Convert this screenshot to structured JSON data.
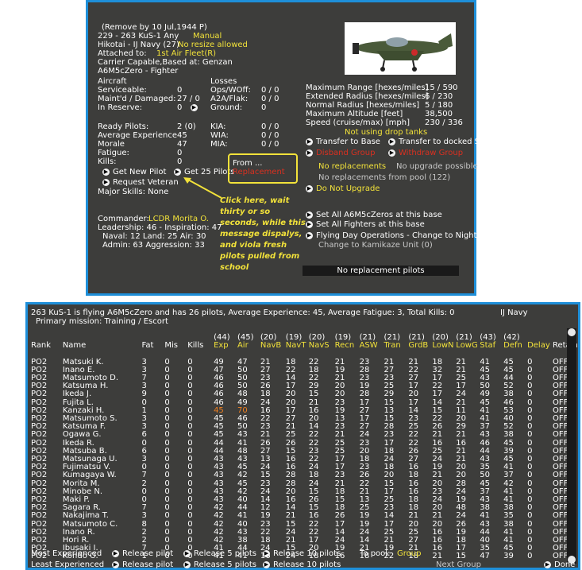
{
  "top": {
    "remove_note": "(Remove by 10 Jul,1944  P)",
    "unit_line": "229 - 263 KuS-1  Any",
    "manual": "Manual",
    "hikotai": "Hikotai - IJ Navy (27)",
    "no_resize": "No resize allowed",
    "attached_label": "Attached to:",
    "attached_value": "1st Air Fleet(R)",
    "carrier": "Carrier Capable,Based at:  Genzan",
    "aircraft_type": "A6M5cZero - Fighter",
    "aircraft_hdr": "Aircraft",
    "losses_hdr": "Losses",
    "left_stats": [
      {
        "label": "Serviceable:",
        "value": "0"
      },
      {
        "label": "Maint'd / Damaged:",
        "value": "27 / 0"
      },
      {
        "label": "In Reserve:",
        "value": "0"
      }
    ],
    "loss_stats": [
      {
        "label": "Ops/WOff:",
        "value": "0 / 0"
      },
      {
        "label": "A2A/Flak:",
        "value": "0 / 0"
      },
      {
        "label": "Ground:",
        "value": "0"
      }
    ],
    "range_stats": [
      {
        "label": "Maximum Range [hexes/miles]",
        "value": "15 / 590"
      },
      {
        "label": "Extended Radius [hexes/miles]",
        "value": "6 / 230"
      },
      {
        "label": "Normal Radius [hexes/miles]",
        "value": "5 / 180"
      },
      {
        "label": "Maximum Altitude [feet]",
        "value": "38,500"
      },
      {
        "label": "Speed (cruise/max) [mph]",
        "value": "230 / 336"
      }
    ],
    "drop_tanks": "Not using drop tanks",
    "pilot_stats": [
      {
        "label": "Ready Pilots:",
        "value": "2 (0)"
      },
      {
        "label": "Average Experience",
        "value": "45"
      },
      {
        "label": "Morale",
        "value": "47"
      },
      {
        "label": "Fatigue:",
        "value": "0"
      },
      {
        "label": "Kills:",
        "value": "0"
      }
    ],
    "kia_stats": [
      {
        "label": "KIA:",
        "value": "0 / 0"
      },
      {
        "label": "WIA:",
        "value": "0 / 0"
      },
      {
        "label": "MIA:",
        "value": "0 / 0"
      }
    ],
    "transfer_base": "Transfer to Base",
    "transfer_docked": "Transfer to docked S",
    "disband": "Disband Group",
    "withdraw": "Withdraw Group",
    "no_replacements": "No replacements",
    "no_upgrade": "No upgrade possible",
    "no_repl_pool": "No replacements from pool (122)",
    "do_not_upgrade": "Do Not Upgrade",
    "get_new_pilot": "Get New Pilot",
    "get_25": "Get 25 Pilots",
    "from_label": "From ...",
    "from_value": "Replacement",
    "request_veteran": "Request Veteran",
    "major_skills": "Major Skills: None",
    "callout_note": "Click here, wait thirty or so seconds, while this message dispalys, and viola fresh pilots pulled from school",
    "commander_label": "Commander:",
    "commander_name": "LCDR Morita O.",
    "leadership": "Leadership: 46 - Inspiration: 47",
    "naval": "Naval: 12  Land: 25  Air: 30",
    "admin": "Admin: 63  Aggression: 33",
    "set_all_zeros": "Set All A6M5cZeros at this base",
    "set_all_fighters": "Set All Fighters at this base",
    "flying_day": "Flying Day Operations - Change to Night",
    "kamikaze": "Change to Kamikaze Unit (0)",
    "no_repl_msg": "No replacement pilots"
  },
  "bottom": {
    "summary": "263 KuS-1 is flying A6M5cZero and has 26 pilots,  Average Experience: 45, Average Fatigue: 3, Total Kills: 0",
    "navy": "IJ Navy",
    "mission": "Primary mission: Training / Escort",
    "avgs": [
      "",
      "",
      "",
      "",
      "",
      "(44)",
      "(45)",
      "(20)",
      "(19)",
      "(20)",
      "(19)",
      "(21)",
      "(21)",
      "(21)",
      "(20)",
      "(21)",
      "(43)",
      "(42)",
      "",
      ""
    ],
    "headers": [
      "Rank",
      "Name",
      "Fat",
      "Mis",
      "Kills",
      "Exp",
      "Air",
      "NavB",
      "NavT",
      "NavS",
      "Recn",
      "ASW",
      "Tran",
      "GrdB",
      "LowN",
      "LowG",
      "Staf",
      "Defn",
      "Delay",
      "Retain"
    ],
    "rows": [
      [
        "PO2",
        "Matsuki K.",
        "3",
        "0",
        "0",
        "49",
        "47",
        "21",
        "18",
        "22",
        "21",
        "23",
        "21",
        "21",
        "18",
        "21",
        "41",
        "45",
        "0",
        "OFF"
      ],
      [
        "PO2",
        "Inano E.",
        "3",
        "0",
        "0",
        "47",
        "50",
        "27",
        "22",
        "18",
        "19",
        "28",
        "27",
        "22",
        "32",
        "21",
        "45",
        "45",
        "0",
        "OFF"
      ],
      [
        "PO2",
        "Matsumoto D.",
        "7",
        "0",
        "0",
        "46",
        "50",
        "23",
        "14",
        "22",
        "21",
        "23",
        "23",
        "27",
        "17",
        "25",
        "43",
        "44",
        "0",
        "OFF"
      ],
      [
        "PO2",
        "Katsuma H.",
        "3",
        "0",
        "0",
        "46",
        "50",
        "26",
        "17",
        "29",
        "20",
        "19",
        "25",
        "17",
        "22",
        "17",
        "50",
        "52",
        "0",
        "OFF"
      ],
      [
        "PO2",
        "Ikeda J.",
        "9",
        "0",
        "0",
        "46",
        "48",
        "18",
        "20",
        "15",
        "20",
        "28",
        "29",
        "20",
        "17",
        "24",
        "49",
        "38",
        "0",
        "OFF"
      ],
      [
        "PO2",
        "Fujita L.",
        "0",
        "0",
        "0",
        "46",
        "49",
        "24",
        "20",
        "21",
        "23",
        "17",
        "15",
        "17",
        "14",
        "21",
        "45",
        "46",
        "0",
        "OFF"
      ],
      [
        "PO2",
        "Kanzaki H.",
        "1",
        "0",
        "0",
        "45",
        "70",
        "16",
        "17",
        "16",
        "19",
        "27",
        "13",
        "14",
        "15",
        "11",
        "41",
        "53",
        "0",
        "OFF"
      ],
      [
        "PO2",
        "Matsumoto S.",
        "3",
        "0",
        "0",
        "45",
        "46",
        "22",
        "27",
        "20",
        "13",
        "17",
        "15",
        "23",
        "22",
        "20",
        "41",
        "40",
        "0",
        "OFF"
      ],
      [
        "PO2",
        "Katsuma F.",
        "3",
        "0",
        "0",
        "45",
        "50",
        "23",
        "21",
        "14",
        "23",
        "27",
        "28",
        "25",
        "26",
        "29",
        "37",
        "52",
        "0",
        "OFF"
      ],
      [
        "PO2",
        "Ogawa G.",
        "6",
        "0",
        "0",
        "45",
        "43",
        "21",
        "25",
        "22",
        "21",
        "24",
        "23",
        "22",
        "21",
        "21",
        "43",
        "38",
        "0",
        "OFF"
      ],
      [
        "PO2",
        "Ikeda R.",
        "0",
        "0",
        "0",
        "44",
        "41",
        "26",
        "26",
        "22",
        "25",
        "23",
        "17",
        "22",
        "16",
        "16",
        "46",
        "45",
        "0",
        "OFF"
      ],
      [
        "PO2",
        "Matsuba B.",
        "6",
        "0",
        "0",
        "44",
        "48",
        "27",
        "15",
        "23",
        "25",
        "20",
        "18",
        "26",
        "25",
        "21",
        "44",
        "39",
        "0",
        "OFF"
      ],
      [
        "PO2",
        "Matsunaga U.",
        "3",
        "0",
        "0",
        "43",
        "43",
        "13",
        "16",
        "22",
        "17",
        "18",
        "24",
        "27",
        "24",
        "21",
        "43",
        "45",
        "0",
        "OFF"
      ],
      [
        "PO2",
        "Fujimatsu V.",
        "0",
        "0",
        "0",
        "43",
        "45",
        "24",
        "16",
        "24",
        "17",
        "23",
        "18",
        "16",
        "19",
        "20",
        "35",
        "41",
        "0",
        "OFF"
      ],
      [
        "PO2",
        "Kumagaya W.",
        "7",
        "0",
        "0",
        "43",
        "42",
        "15",
        "28",
        "18",
        "23",
        "26",
        "20",
        "18",
        "21",
        "20",
        "50",
        "37",
        "0",
        "OFF"
      ],
      [
        "PO2",
        "Morita M.",
        "2",
        "0",
        "0",
        "43",
        "45",
        "23",
        "28",
        "24",
        "21",
        "22",
        "15",
        "16",
        "20",
        "28",
        "45",
        "42",
        "0",
        "OFF"
      ],
      [
        "PO2",
        "Minobe N.",
        "0",
        "0",
        "0",
        "43",
        "42",
        "24",
        "20",
        "15",
        "18",
        "21",
        "17",
        "16",
        "23",
        "24",
        "37",
        "41",
        "0",
        "OFF"
      ],
      [
        "PO2",
        "Maki P.",
        "0",
        "0",
        "0",
        "43",
        "40",
        "14",
        "16",
        "26",
        "15",
        "13",
        "25",
        "18",
        "24",
        "19",
        "43",
        "41",
        "0",
        "OFF"
      ],
      [
        "PO2",
        "Sagara R.",
        "7",
        "0",
        "0",
        "42",
        "44",
        "12",
        "14",
        "15",
        "18",
        "25",
        "23",
        "18",
        "20",
        "48",
        "38",
        "38",
        "0",
        "OFF"
      ],
      [
        "PO2",
        "Nakajima T.",
        "3",
        "0",
        "0",
        "42",
        "41",
        "19",
        "21",
        "16",
        "26",
        "19",
        "14",
        "21",
        "21",
        "24",
        "41",
        "35",
        "0",
        "OFF"
      ],
      [
        "PO2",
        "Matsumoto C.",
        "8",
        "0",
        "0",
        "42",
        "40",
        "23",
        "15",
        "22",
        "17",
        "19",
        "17",
        "20",
        "20",
        "26",
        "43",
        "38",
        "0",
        "OFF"
      ],
      [
        "PO2",
        "Inano R.",
        "2",
        "0",
        "0",
        "42",
        "43",
        "22",
        "24",
        "22",
        "14",
        "24",
        "25",
        "25",
        "16",
        "19",
        "44",
        "41",
        "0",
        "OFF"
      ],
      [
        "PO2",
        "Hori R.",
        "2",
        "0",
        "0",
        "42",
        "38",
        "18",
        "21",
        "17",
        "24",
        "14",
        "21",
        "27",
        "16",
        "18",
        "40",
        "41",
        "0",
        "OFF"
      ],
      [
        "PO2",
        "Ibusaki I.",
        "7",
        "0",
        "0",
        "41",
        "44",
        "24",
        "15",
        "20",
        "19",
        "21",
        "19",
        "21",
        "16",
        "17",
        "35",
        "45",
        "0",
        "OFF"
      ],
      [
        "PO2",
        "Kondo O.",
        "1",
        "0",
        "0",
        "41",
        "41",
        "16",
        "24",
        "18",
        "16",
        "18",
        "22",
        "18",
        "21",
        "15",
        "47",
        "39",
        "0",
        "OFF"
      ]
    ],
    "most_exp": "Most Experienced",
    "least_exp": "Least Experienced",
    "release_pilot": "Release pilot",
    "release_5": "Release 5 pilots",
    "release_10": "Release 10 pilots",
    "to_pool": "To pool:",
    "group": "Group",
    "next_group": "Next Group",
    "done": "Done"
  }
}
